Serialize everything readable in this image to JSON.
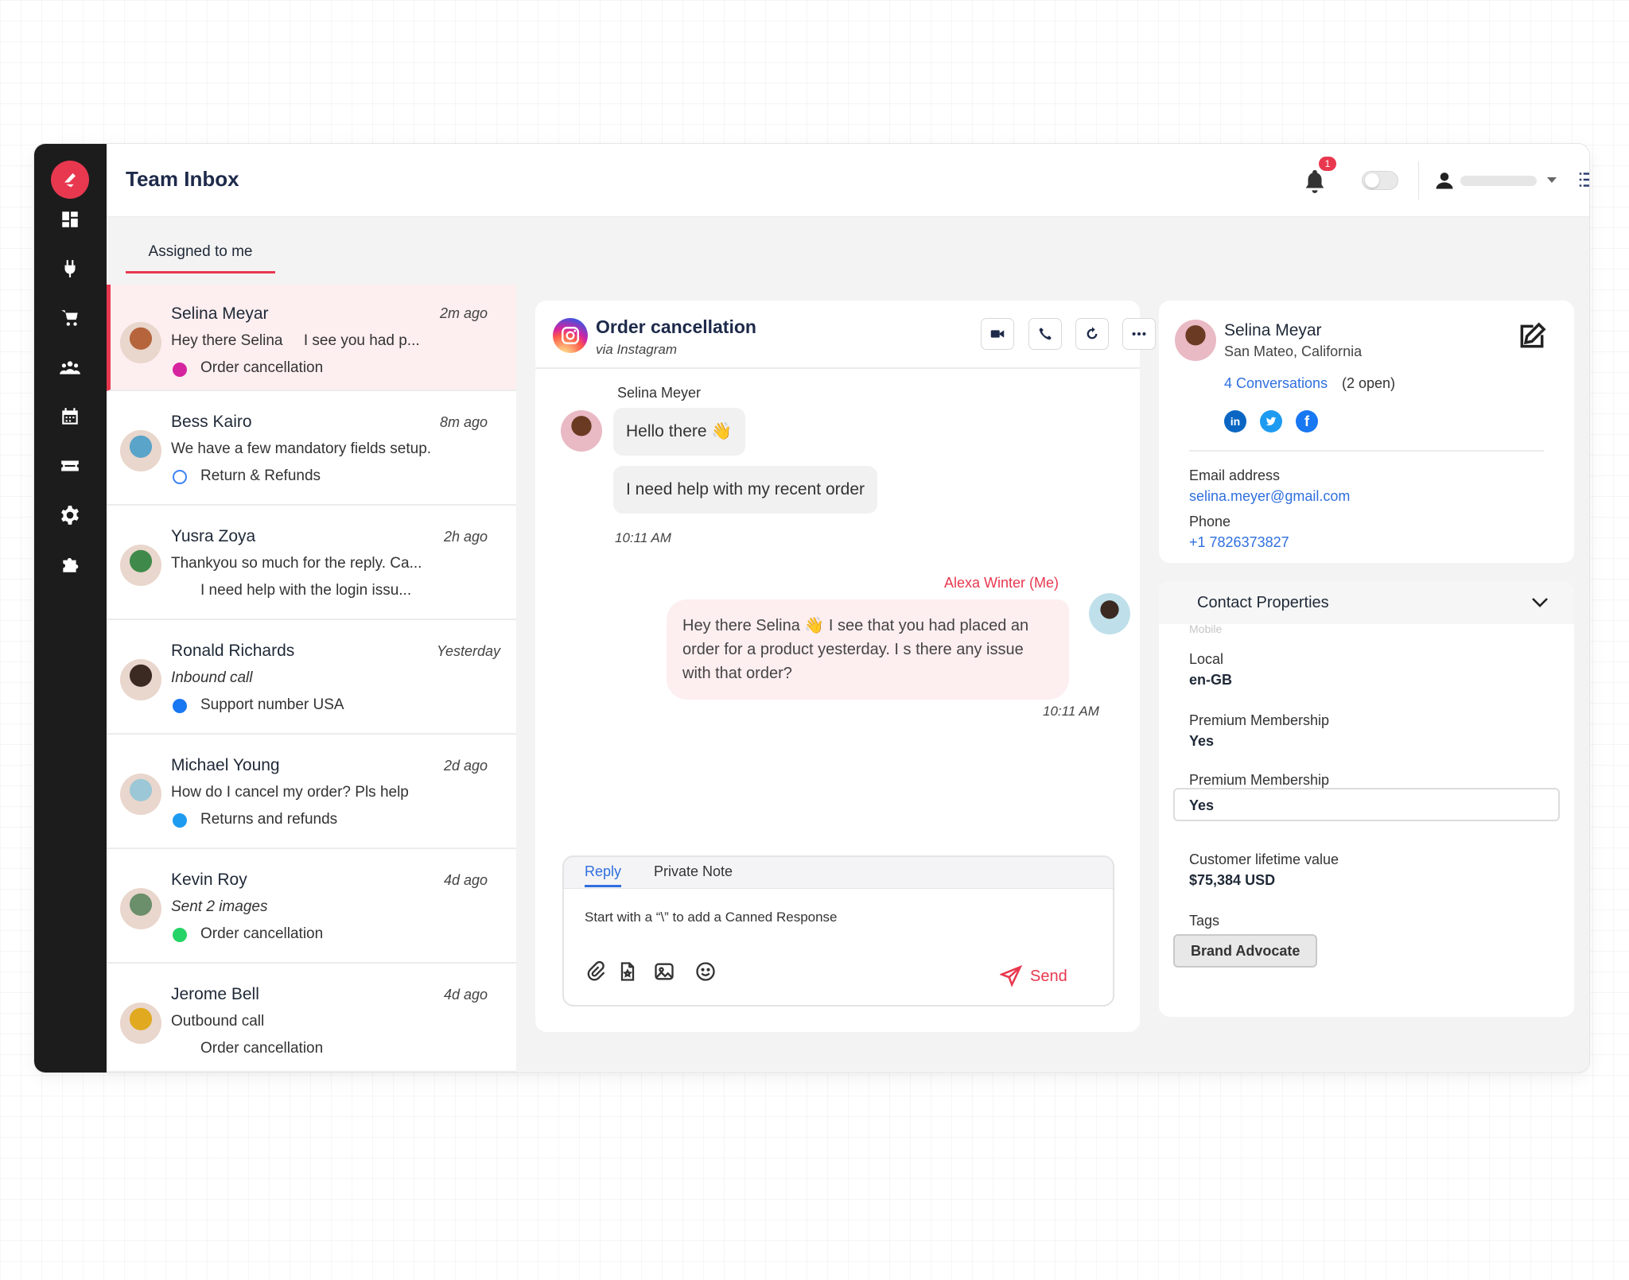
{
  "app": {
    "title": "Team Inbox",
    "notification_count": "1"
  },
  "tabs": {
    "assigned": "Assigned to me"
  },
  "conversations": [
    {
      "name": "Selina Meyar",
      "time": "2m ago",
      "preview": "Hey there Selina     I see you had p...",
      "topic": "Order cancellation",
      "channel": "instagram",
      "avatar_color": "#b5643c"
    },
    {
      "name": "Bess Kairo",
      "time": "8m ago",
      "preview": "We have a few mandatory fields setup.",
      "topic": "Return & Refunds",
      "channel": "web",
      "avatar_color": "#5aa3c9"
    },
    {
      "name": "Yusra Zoya",
      "time": "2h ago",
      "preview": "Thankyou so much for the reply. Ca...",
      "topic": "I need help with the login issu...",
      "channel": "none",
      "avatar_color": "#3f8a4b"
    },
    {
      "name": "Ronald Richards",
      "time": "Yesterday",
      "preview": "Inbound call",
      "topic": "Support number USA",
      "channel": "facebook",
      "avatar_color": "#3b2a22"
    },
    {
      "name": "Michael Young",
      "time": "2d ago",
      "preview": "How do I cancel my order? Pls help",
      "topic": "Returns and refunds",
      "channel": "twitter",
      "avatar_color": "#9cc7d6"
    },
    {
      "name": "Kevin Roy",
      "time": "4d ago",
      "preview": "Sent 2 images",
      "topic": "Order cancellation",
      "channel": "whatsapp",
      "avatar_color": "#6a8f6a"
    },
    {
      "name": "Jerome Bell",
      "time": "4d ago",
      "preview": "Outbound call",
      "topic": "Order cancellation",
      "channel": "none",
      "avatar_color": "#e0a91f"
    }
  ],
  "chat": {
    "title": "Order cancellation",
    "subtitle": "via Instagram",
    "sender_name": "Selina Meyer",
    "msg1": "Hello there 👋",
    "msg2": "I need help with my recent order",
    "time_in": "10:11 AM",
    "me_name": "Alexa Winter (Me)",
    "reply_msg": "Hey there Selina 👋 I see that you had placed an order for a product yesterday. I s there any issue with that order?",
    "time_out": "10:11 AM"
  },
  "reply_box": {
    "tab_reply": "Reply",
    "tab_note": "Private Note",
    "placeholder": "Start with a “\\” to add a Canned Response",
    "send": "Send"
  },
  "contact": {
    "name": "Selina Meyar",
    "location": "San Mateo, California",
    "conversations": "4 Conversations",
    "open": "(2 open)",
    "email_label": "Email address",
    "email": "selina.meyer@gmail.com",
    "phone_label": "Phone",
    "phone": "+1 7826373827"
  },
  "properties": {
    "title": "Contact Properties",
    "ghost": "Mobile",
    "local_label": "Local",
    "local_value": "en-GB",
    "premium_label": "Premium Membership",
    "premium_value": "Yes",
    "premium2_label": "Premium Membership",
    "premium2_value": "Yes",
    "clv_label": "Customer lifetime value",
    "clv_value": "$75,384 USD",
    "tags_label": "Tags",
    "tag": "Brand Advocate"
  }
}
